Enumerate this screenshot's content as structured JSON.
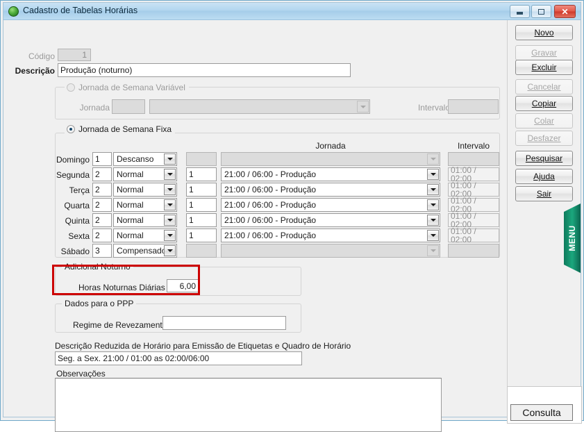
{
  "window": {
    "title": "Cadastro de Tabelas Horárias",
    "icon": "green-sphere-icon",
    "minimize_label": "minimize-icon",
    "maximize_label": "maximize-icon",
    "close_label": "✕"
  },
  "form": {
    "codigo_label": "Código",
    "codigo_value": "1",
    "descricao_label": "Descrição",
    "descricao_value": "Produção (noturno)"
  },
  "variable_week": {
    "radio_label": "Jornada de Semana Variável",
    "selected": false,
    "jornada_label": "Jornada",
    "jornada_num": "",
    "jornada_combo": "",
    "intervalo_label": "Intervalo",
    "intervalo_value": ""
  },
  "fixed_week": {
    "radio_label": "Jornada de Semana Fixa",
    "selected": true,
    "headers": {
      "jornada": "Jornada",
      "intervalo": "Intervalo"
    },
    "rows": [
      {
        "day": "Domingo",
        "num": "1",
        "tipo": "Descanso",
        "seq": "",
        "jornada": "",
        "intervalo": "",
        "enabled": false
      },
      {
        "day": "Segunda",
        "num": "2",
        "tipo": "Normal",
        "seq": "1",
        "jornada": "21:00 / 06:00 - Produção",
        "intervalo": "01:00 / 02:00",
        "enabled": true
      },
      {
        "day": "Terça",
        "num": "2",
        "tipo": "Normal",
        "seq": "1",
        "jornada": "21:00 / 06:00 - Produção",
        "intervalo": "01:00 / 02:00",
        "enabled": true
      },
      {
        "day": "Quarta",
        "num": "2",
        "tipo": "Normal",
        "seq": "1",
        "jornada": "21:00 / 06:00 - Produção",
        "intervalo": "01:00 / 02:00",
        "enabled": true
      },
      {
        "day": "Quinta",
        "num": "2",
        "tipo": "Normal",
        "seq": "1",
        "jornada": "21:00 / 06:00 - Produção",
        "intervalo": "01:00 / 02:00",
        "enabled": true
      },
      {
        "day": "Sexta",
        "num": "2",
        "tipo": "Normal",
        "seq": "1",
        "jornada": "21:00 / 06:00 - Produção",
        "intervalo": "01:00 / 02:00",
        "enabled": true
      },
      {
        "day": "Sábado",
        "num": "3",
        "tipo": "Compensado",
        "seq": "",
        "jornada": "",
        "intervalo": "",
        "enabled": false
      }
    ]
  },
  "adicional_noturno": {
    "group_label": "Adicional Noturno",
    "horas_label": "Horas Noturnas Diárias",
    "horas_value": "6,00",
    "highlight_color": "#cc0000"
  },
  "ppp": {
    "group_label": "Dados para o PPP",
    "regime_label": "Regime de Revezamento",
    "regime_value": ""
  },
  "descricao_reduzida": {
    "label": "Descrição Reduzida de Horário para Emissão de Etiquetas e Quadro de Horário",
    "value": "Seg. a Sex. 21:00 / 01:00 as 02:00/06:00"
  },
  "observacoes": {
    "label": "Observações",
    "value": ""
  },
  "buttons": [
    {
      "label": "Novo",
      "accel": "N",
      "enabled": true
    },
    {
      "label": "Gravar",
      "accel": "G",
      "enabled": false
    },
    {
      "label": "Excluir",
      "accel": "E",
      "enabled": true
    },
    {
      "label": "Cancelar",
      "accel": "C",
      "enabled": false
    },
    {
      "label": "Copiar",
      "accel": "p",
      "enabled": true
    },
    {
      "label": "Colar",
      "accel": "l",
      "enabled": false
    },
    {
      "label": "Desfazer",
      "accel": "D",
      "enabled": false
    },
    {
      "label": "Pesquisar",
      "accel": "P",
      "enabled": true
    },
    {
      "label": "Ajuda",
      "accel": "A",
      "enabled": true
    },
    {
      "label": "Sair",
      "accel": "S",
      "enabled": true
    }
  ],
  "menu_tab": {
    "label": "MENU",
    "color": "#1ba77d"
  },
  "consulta_button": {
    "label": "Consulta"
  }
}
